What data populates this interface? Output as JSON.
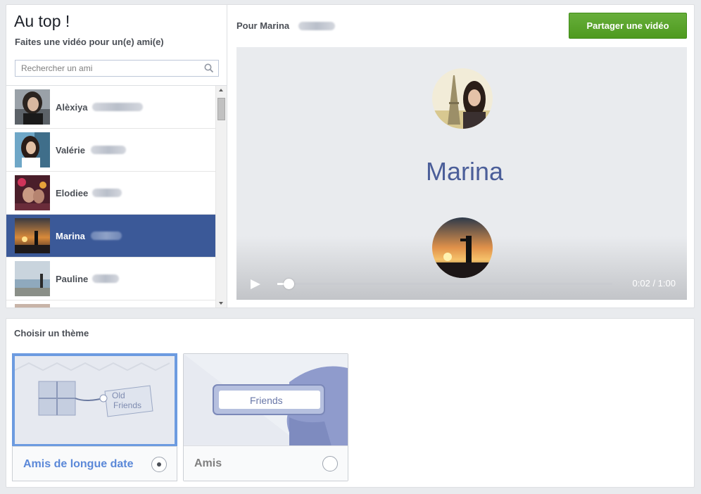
{
  "sidebar": {
    "title": "Au top !",
    "subtitle": "Faites une vidéo pour un(e) ami(e)",
    "search_placeholder": "Rechercher un ami",
    "friends": [
      {
        "name": "Alèxiya"
      },
      {
        "name": "Valérie"
      },
      {
        "name": "Elodiee"
      },
      {
        "name": "Marina",
        "selected": true
      },
      {
        "name": "Pauline"
      }
    ]
  },
  "preview": {
    "for_label": "Pour Marina",
    "share_label": "Partager une vidéo",
    "video_name": "Marina",
    "time": "0:02 / 1:00",
    "progress": 0.033
  },
  "themes": {
    "heading": "Choisir un thème",
    "cards": [
      {
        "label": "Amis de longue date",
        "thumb_text_1": "Old",
        "thumb_text_2": "Friends",
        "selected": true
      },
      {
        "label": "Amis",
        "thumb_text": "Friends",
        "selected": false
      }
    ]
  },
  "colors": {
    "selected_row": "#3b5998",
    "share_button": "#5aa22c",
    "theme_selected_border": "#6c9be0",
    "video_name": "#4b5e99"
  }
}
